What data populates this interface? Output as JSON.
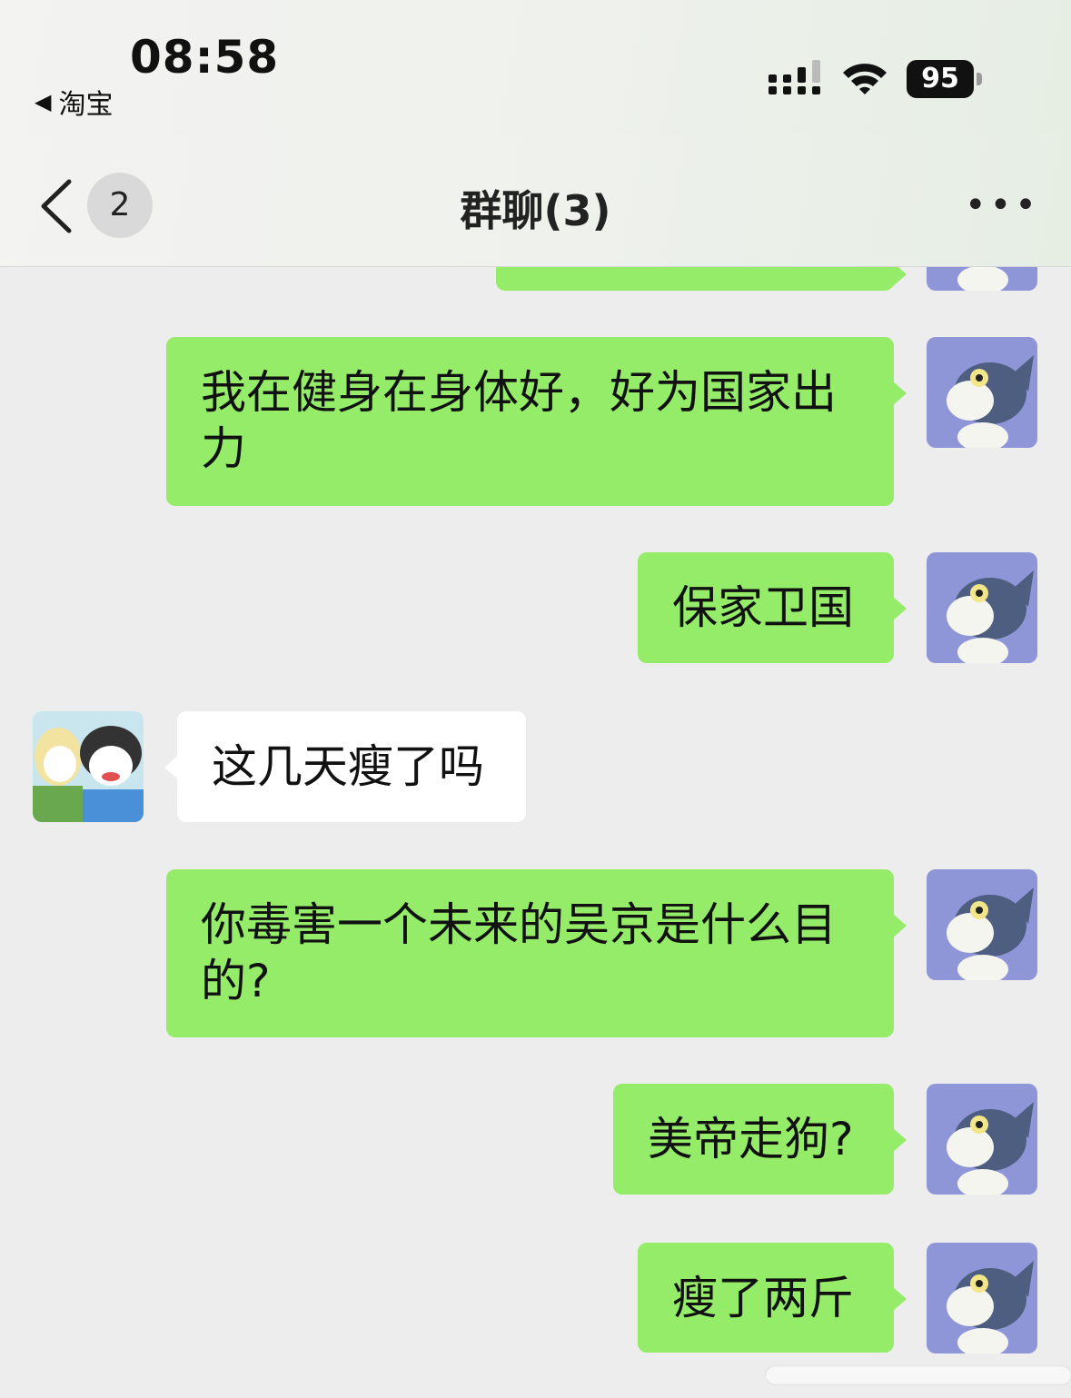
{
  "status_bar": {
    "time": "08:58",
    "back_app": "淘宝",
    "battery": "95",
    "icons": [
      "signal-icon",
      "wifi-icon",
      "battery-icon"
    ]
  },
  "nav": {
    "back_icon": "chevron-left-icon",
    "unread_count": "2",
    "title": "群聊(3)",
    "more_icon": "more-dots-icon"
  },
  "colors": {
    "outgoing_bubble": "#95ec69",
    "incoming_bubble": "#ffffff",
    "background": "#ededed"
  },
  "messages": [
    {
      "sender": "me",
      "text": ""
    },
    {
      "sender": "me",
      "text": "我在健身在身体好，好为国家出力"
    },
    {
      "sender": "me",
      "text": "保家卫国"
    },
    {
      "sender": "other",
      "text": "这几天瘦了吗"
    },
    {
      "sender": "me",
      "text": "你毒害一个未来的吴京是什么目的?"
    },
    {
      "sender": "me",
      "text": "美帝走狗?"
    },
    {
      "sender": "me",
      "text": "瘦了两斤"
    }
  ]
}
